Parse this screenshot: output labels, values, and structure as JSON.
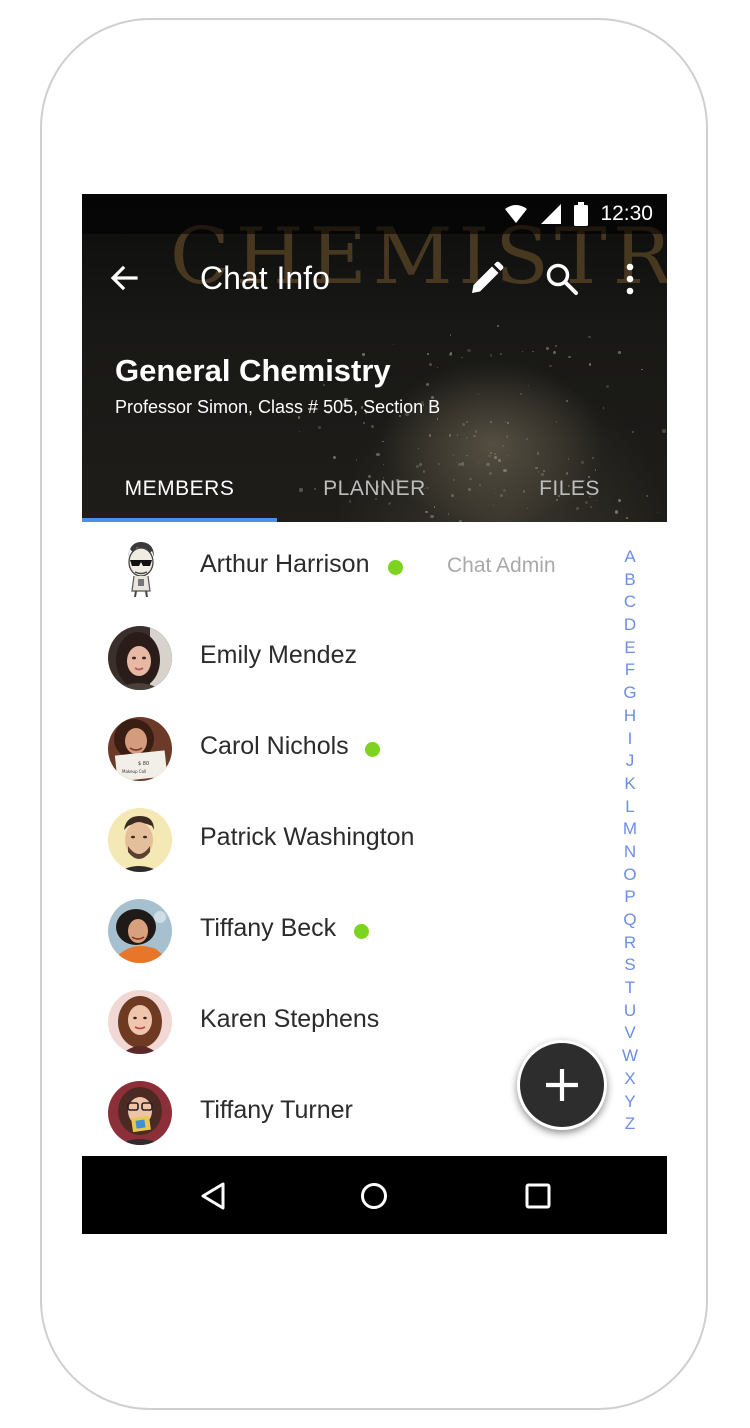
{
  "status_bar": {
    "time": "12:30"
  },
  "app_bar": {
    "title": "Chat Info",
    "back_icon": "arrow-back-icon",
    "edit_icon": "pencil-icon",
    "search_icon": "search-icon",
    "more_icon": "more-vert-icon"
  },
  "group": {
    "name": "General Chemistry",
    "subtitle": "Professor Simon, Class # 505, Section B",
    "backdrop_text": "CHEMISTRY"
  },
  "tabs": [
    {
      "label": "MEMBERS",
      "active": true
    },
    {
      "label": "PLANNER",
      "active": false
    },
    {
      "label": "FILES",
      "active": false
    }
  ],
  "members": [
    {
      "name": "Arthur Harrison",
      "online": true,
      "role": "Chat Admin"
    },
    {
      "name": "Emily Mendez",
      "online": false,
      "role": ""
    },
    {
      "name": "Carol Nichols",
      "online": true,
      "role": ""
    },
    {
      "name": "Patrick Washington",
      "online": false,
      "role": ""
    },
    {
      "name": "Tiffany Beck",
      "online": true,
      "role": ""
    },
    {
      "name": "Karen Stephens",
      "online": false,
      "role": ""
    },
    {
      "name": "Tiffany Turner",
      "online": false,
      "role": ""
    }
  ],
  "alphabet": [
    "A",
    "B",
    "C",
    "D",
    "E",
    "F",
    "G",
    "H",
    "I",
    "J",
    "K",
    "L",
    "M",
    "N",
    "O",
    "P",
    "Q",
    "R",
    "S",
    "T",
    "U",
    "V",
    "W",
    "X",
    "Y",
    "Z"
  ],
  "fab": {
    "icon": "plus-icon"
  },
  "nav_bar": {
    "back_icon": "nav-back-icon",
    "home_icon": "nav-home-icon",
    "recents_icon": "nav-recents-icon"
  },
  "colors": {
    "accent": "#4a8fe8",
    "online": "#7ed321",
    "index_letters": "#6d8ee6",
    "fab": "#2d2d2d"
  }
}
